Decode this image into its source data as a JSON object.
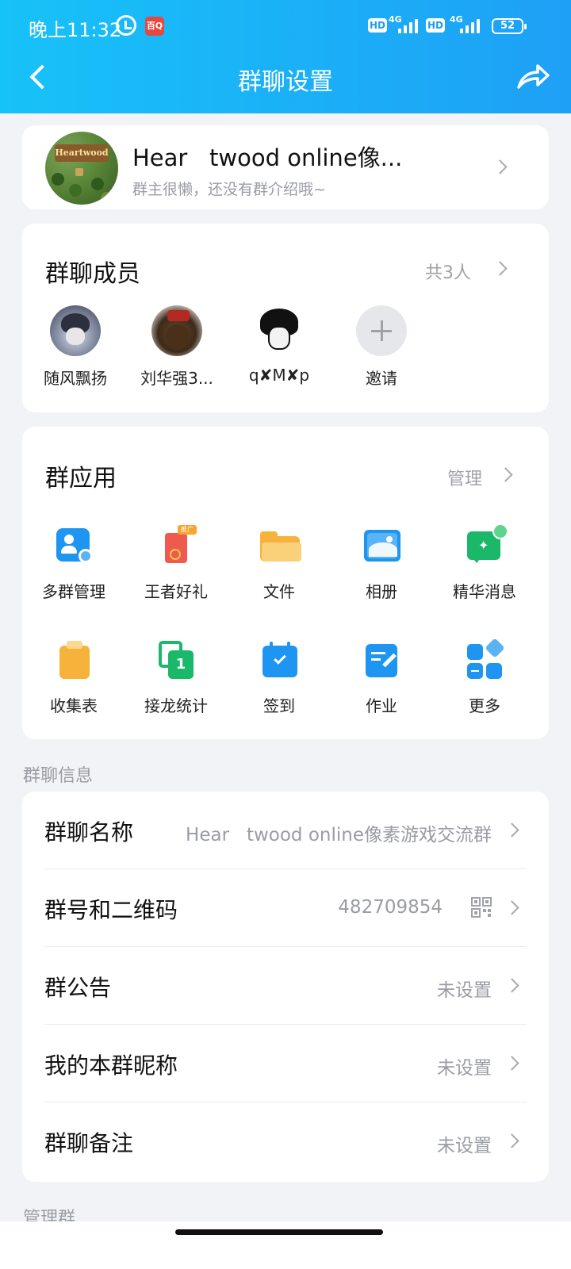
{
  "status_bar": {
    "time": "晚上11:32",
    "app_badge": "百Q",
    "net1_badge": "HD",
    "net1_type": "4G",
    "net2_badge": "HD",
    "net2_type": "4G",
    "battery": "52"
  },
  "header": {
    "title": "群聊设置"
  },
  "group": {
    "name": "Hear   twood online像...",
    "description": "群主很懒，还没有群介绍哦~",
    "avatar_sign": "Heartwood"
  },
  "members": {
    "title": "群聊成员",
    "count": "共3人",
    "items": [
      {
        "name": "随风飘扬"
      },
      {
        "name": "刘华强3..."
      },
      {
        "name": "q✘M✘p"
      },
      {
        "name": "邀请"
      }
    ]
  },
  "apps": {
    "title": "群应用",
    "manage": "管理",
    "promo_badge": "推广",
    "signup_number": "1",
    "items": [
      {
        "label": "多群管理",
        "icon": "multi-group-icon"
      },
      {
        "label": "王者好礼",
        "icon": "gift-icon"
      },
      {
        "label": "文件",
        "icon": "folder-icon"
      },
      {
        "label": "相册",
        "icon": "album-icon"
      },
      {
        "label": "精华消息",
        "icon": "essence-message-icon"
      },
      {
        "label": "收集表",
        "icon": "clipboard-icon"
      },
      {
        "label": "接龙统计",
        "icon": "chain-stats-icon"
      },
      {
        "label": "签到",
        "icon": "checkin-icon"
      },
      {
        "label": "作业",
        "icon": "homework-icon"
      },
      {
        "label": "更多",
        "icon": "more-apps-icon"
      }
    ]
  },
  "info": {
    "section_label": "群聊信息",
    "rows": [
      {
        "key": "群聊名称",
        "value": "Hear   twood online像素游戏交流群"
      },
      {
        "key": "群号和二维码",
        "value": "482709854"
      },
      {
        "key": "群公告",
        "value": "未设置"
      },
      {
        "key": "我的本群昵称",
        "value": "未设置"
      },
      {
        "key": "群聊备注",
        "value": "未设置"
      }
    ]
  },
  "manage_section": {
    "label": "管理群"
  },
  "colors": {
    "header_start": "#17c2f8",
    "header_end": "#1ea0f6",
    "background": "#f2f3f7",
    "accent_blue": "#1e95f0"
  }
}
